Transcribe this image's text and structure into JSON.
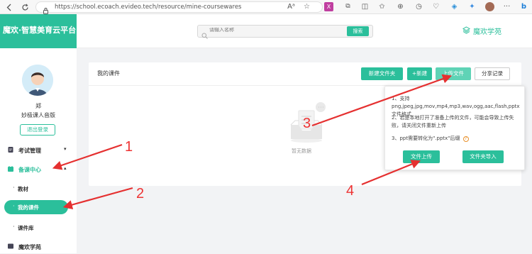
{
  "browser": {
    "url": "https://school.ecoach.evideo.tech/resource/mine-coursewares",
    "icons": [
      "back-icon",
      "refresh-icon",
      "lock-icon",
      "read-aloud-icon",
      "favorite-icon",
      "extension-icon",
      "split-icon",
      "collections-icon",
      "history-icon",
      "shield-icon",
      "browser-essentials-icon",
      "profile-avatar",
      "bing-icon"
    ]
  },
  "header": {
    "logo_text": "魔欢·智慧美育云平台",
    "search_placeholder": "请输入名称",
    "search_button": "搜索",
    "academy_link": "魔欢学苑"
  },
  "sidebar": {
    "user_name": "郑",
    "user_org": "妙极课人音版",
    "logout": "退出登录",
    "menu": [
      {
        "label": "考试管理",
        "icon": "exam-icon",
        "chevron": "▾",
        "active": false
      },
      {
        "label": "备课中心",
        "icon": "prepare-icon",
        "chevron": "▴",
        "active": true
      }
    ],
    "submenu": [
      {
        "label": "教材"
      },
      {
        "label": "我的课件"
      },
      {
        "label": "课件库"
      }
    ],
    "bottom_item": "魔欢学苑"
  },
  "main": {
    "title": "我的课件",
    "btn_new_folder": "新建文件夹",
    "btn_new": "+新建",
    "btn_upload": "上传文件",
    "btn_share": "分享记录",
    "empty_text": "暂无数据"
  },
  "popover": {
    "line1": "1、支持png,jpeg,jpg,mov,mp4,mp3,wav,ogg,aac,flash,pptx文件格式",
    "line2": "2、若是本地打开了准备上传的文件，可能会导致上传失败，请关闭文件重新上传",
    "line3": "3、ppt需要转化为\".pptx\"后缀",
    "btn_upload": "文件上传",
    "btn_folder": "文件夹导入"
  },
  "annotations": [
    "1",
    "2",
    "3",
    "4"
  ],
  "colors": {
    "accent": "#2bbf9b",
    "arrow": "#e53030"
  }
}
